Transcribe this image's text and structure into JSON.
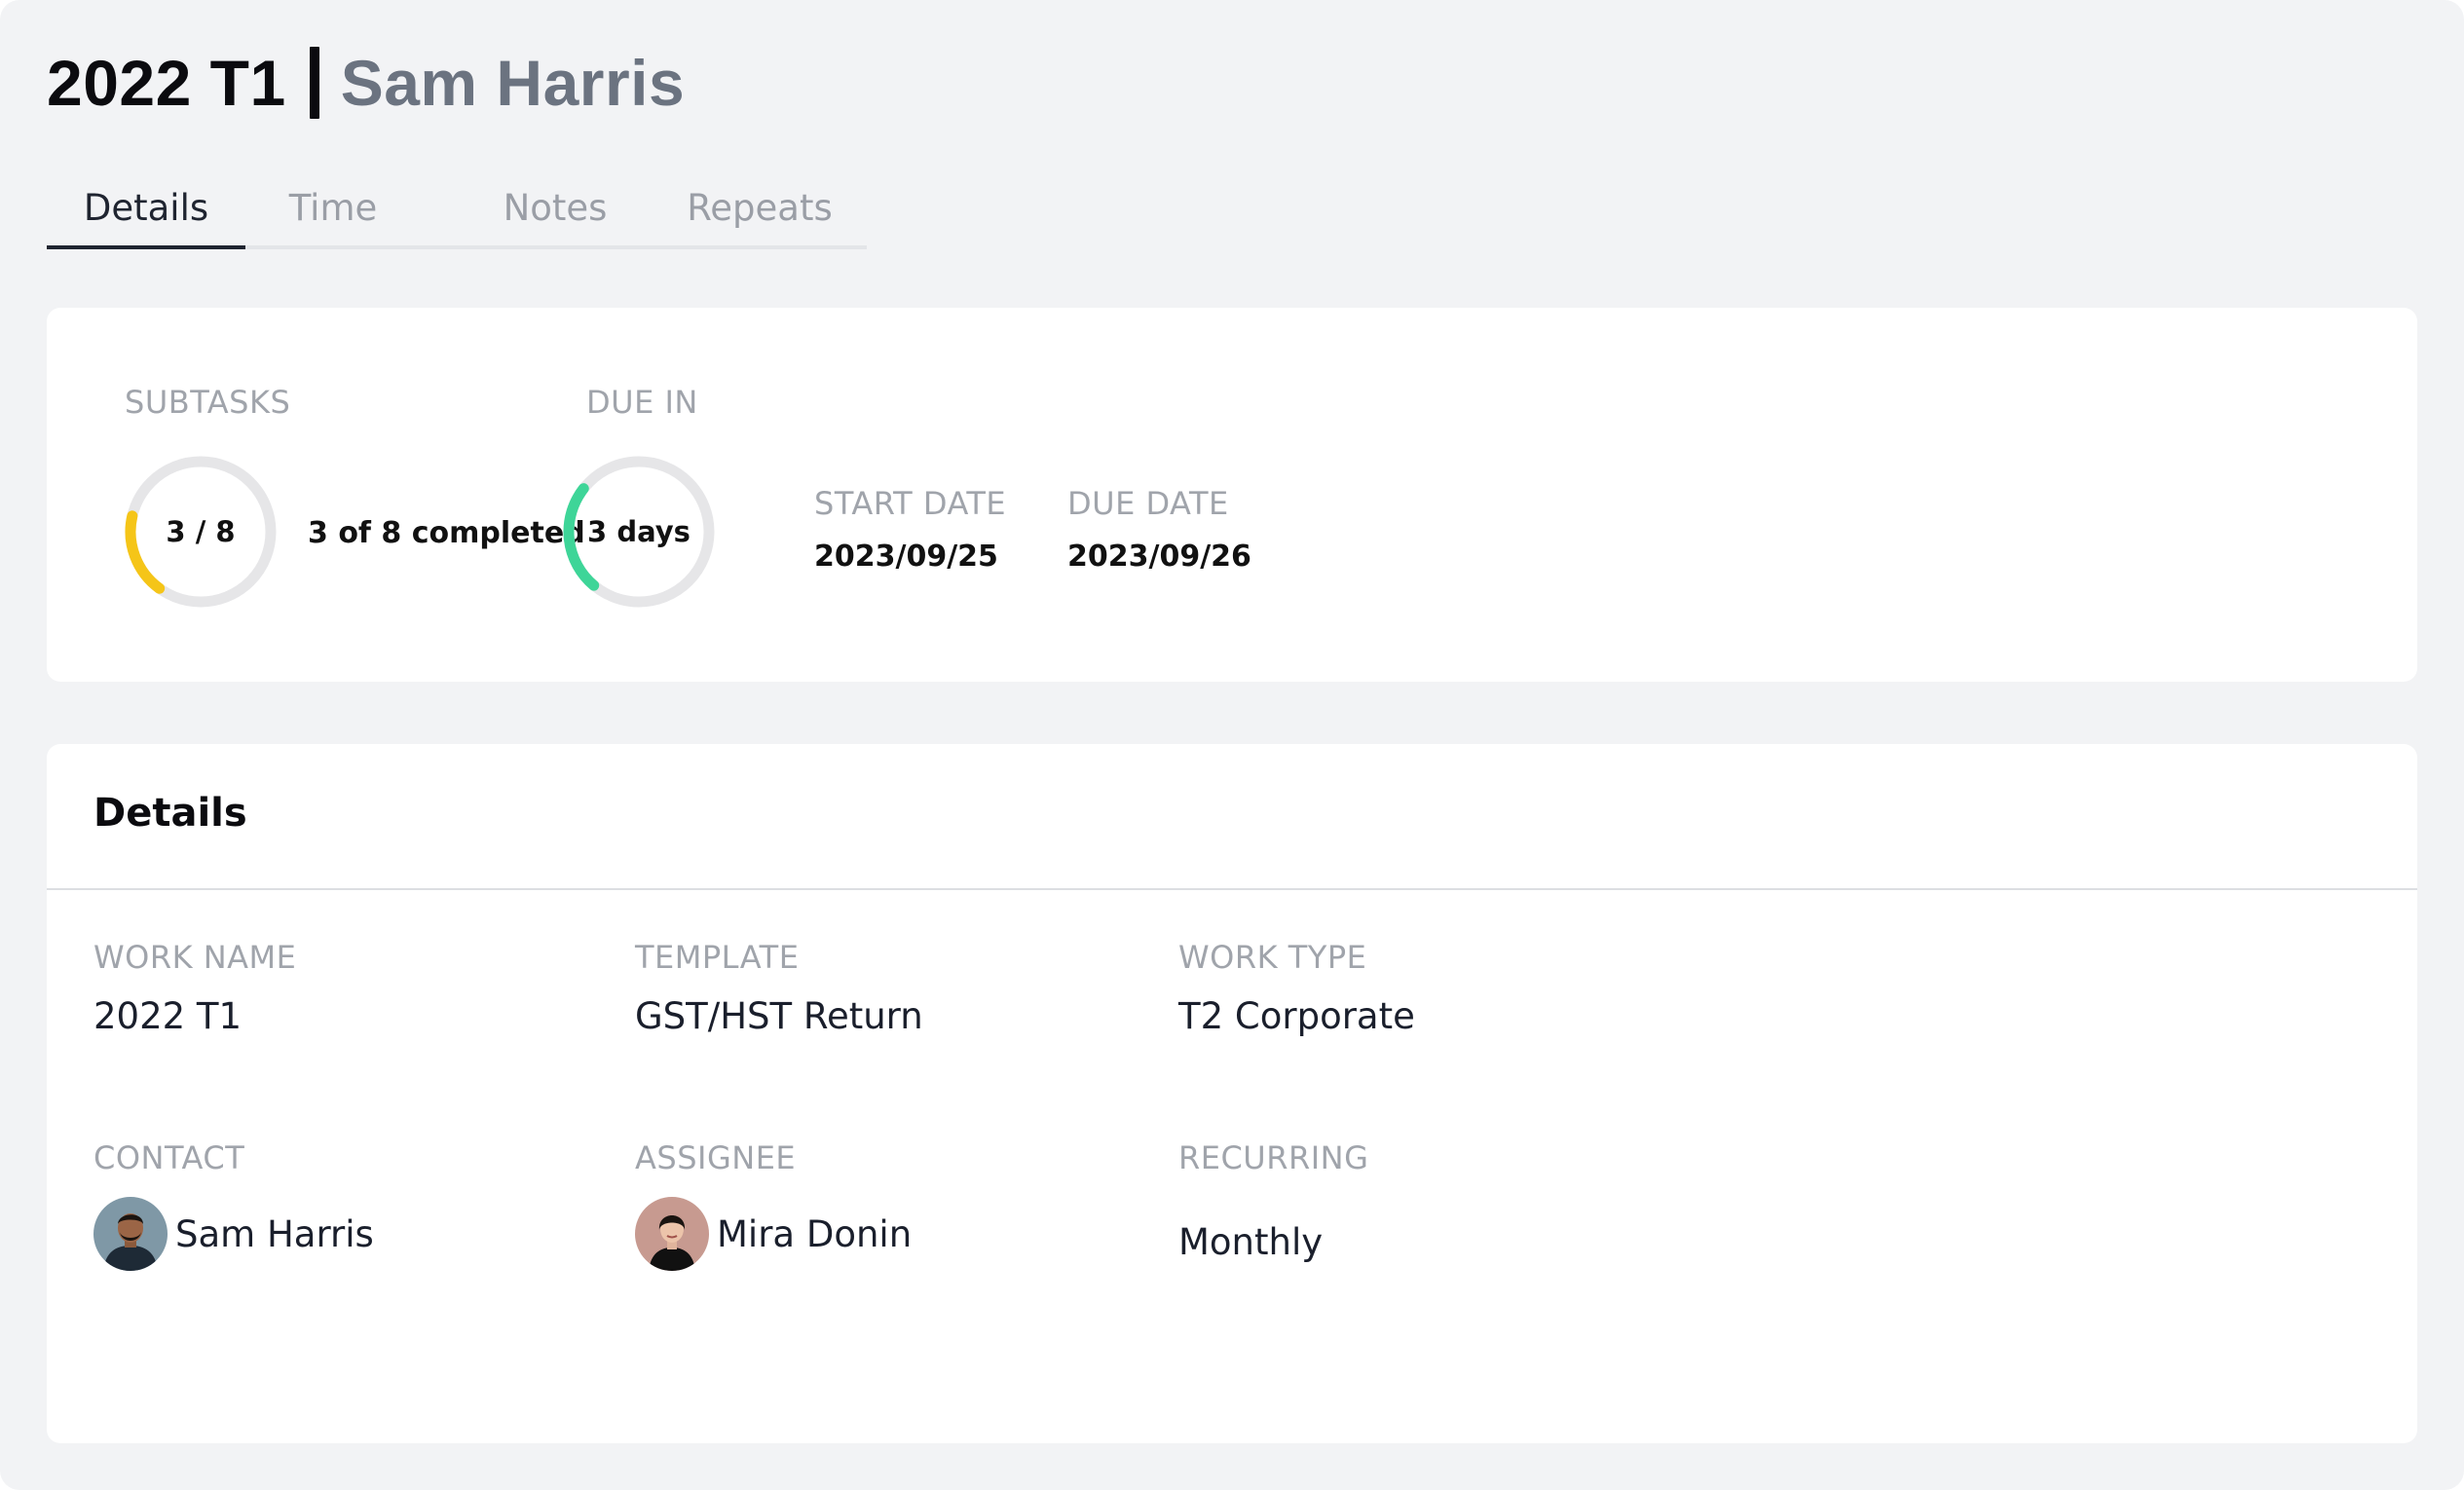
{
  "header": {
    "work_name": "2022 T1",
    "contact_name": "Sam Harris"
  },
  "tabs": [
    {
      "label": "Details",
      "active": true
    },
    {
      "label": "Time",
      "active": false
    },
    {
      "label": "Notes",
      "active": false
    },
    {
      "label": "Repeats",
      "active": false
    }
  ],
  "stats": {
    "subtasks_label": "SUBTASKS",
    "subtasks_ring_text": "3 / 8",
    "subtasks_completed": 3,
    "subtasks_total": 8,
    "subtasks_summary": "3 of 8 completed",
    "subtasks_color": "#f5c518",
    "due_in_label": "DUE IN",
    "due_in_text": "3 days",
    "due_in_color": "#3ed598",
    "start_date_label": "START DATE",
    "start_date": "2023/09/25",
    "due_date_label": "DUE DATE",
    "due_date": "2023/09/26"
  },
  "details": {
    "title": "Details",
    "work_name_label": "WORK NAME",
    "work_name": "2022 T1",
    "template_label": "TEMPLATE",
    "template": "GST/HST Return",
    "work_type_label": "WORK TYPE",
    "work_type": "T2 Corporate",
    "contact_label": "CONTACT",
    "contact": "Sam Harris",
    "assignee_label": "ASSIGNEE",
    "assignee": "Mira Donin",
    "recurring_label": "RECURRING",
    "recurring": "Monthly"
  },
  "icons": {
    "contact_avatar": "avatar-sam-harris",
    "assignee_avatar": "avatar-mira-donin"
  }
}
